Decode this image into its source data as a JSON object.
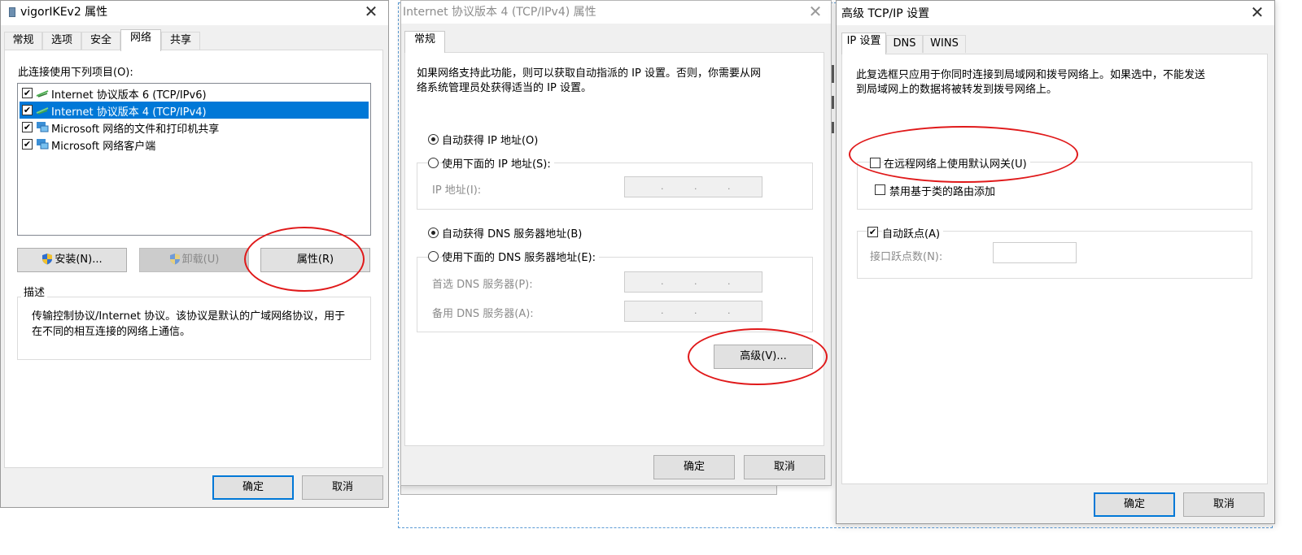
{
  "dlg1": {
    "title": "vigorIKEv2 属性",
    "tabs": [
      "常规",
      "选项",
      "安全",
      "网络",
      "共享"
    ],
    "list_label": "此连接使用下列项目(O):",
    "items": [
      {
        "label": "Internet 协议版本 6 (TCP/IPv6)",
        "checked": true,
        "selected": false
      },
      {
        "label": "Internet 协议版本 4 (TCP/IPv4)",
        "checked": true,
        "selected": true
      },
      {
        "label": "Microsoft 网络的文件和打印机共享",
        "checked": true,
        "selected": false
      },
      {
        "label": "Microsoft 网络客户端",
        "checked": true,
        "selected": false
      }
    ],
    "install_label": "安装(N)...",
    "uninstall_label": "卸载(U)",
    "properties_label": "属性(R)",
    "desc_title": "描述",
    "desc_line1": "传输控制协议/Internet 协议。该协议是默认的广域网络协议，用于",
    "desc_line2": "在不同的相互连接的网络上通信。",
    "ok_label": "确定",
    "cancel_label": "取消"
  },
  "dlg2": {
    "title": "Internet 协议版本 4 (TCP/IPv4) 属性",
    "tab": "常规",
    "intro_line1": "如果网络支持此功能，则可以获取自动指派的 IP 设置。否则，你需要从网",
    "intro_line2": "络系统管理员处获得适当的 IP 设置。",
    "auto_ip_label": "自动获得 IP 地址(O)",
    "manual_ip_label": "使用下面的 IP 地址(S):",
    "ip_address_label": "IP 地址(I):",
    "auto_dns_label": "自动获得 DNS 服务器地址(B)",
    "manual_dns_label": "使用下面的 DNS 服务器地址(E):",
    "preferred_dns_label": "首选 DNS 服务器(P):",
    "alternate_dns_label": "备用 DNS 服务器(A):",
    "advanced_label": "高级(V)...",
    "ok_label": "确定",
    "cancel_label": "取消",
    "auto_ip_selected": true,
    "auto_dns_selected": true
  },
  "dlg3": {
    "title": "高级 TCP/IP 设置",
    "tabs": [
      "IP 设置",
      "DNS",
      "WINS"
    ],
    "info_line1": "此复选框只应用于你同时连接到局域网和拨号网络上。如果选中，不能发送",
    "info_line2": "到局域网上的数据将被转发到拨号网络上。",
    "default_gateway_label": "在远程网络上使用默认网关(U)",
    "default_gateway_checked": false,
    "disable_class_route_label": "禁用基于类的路由添加",
    "disable_class_route_checked": false,
    "auto_metric_label": "自动跃点(A)",
    "auto_metric_checked": true,
    "interface_metric_label": "接口跃点数(N):",
    "interface_metric_value": "",
    "ok_label": "确定",
    "cancel_label": "取消"
  },
  "icons": {
    "check_glyph": "✔",
    "close_glyph": "✕",
    "ip_dot": "."
  },
  "colors": {
    "selection": "#0078d7",
    "highlight_ring": "#e0191a",
    "default_button_border": "#0078d7"
  }
}
